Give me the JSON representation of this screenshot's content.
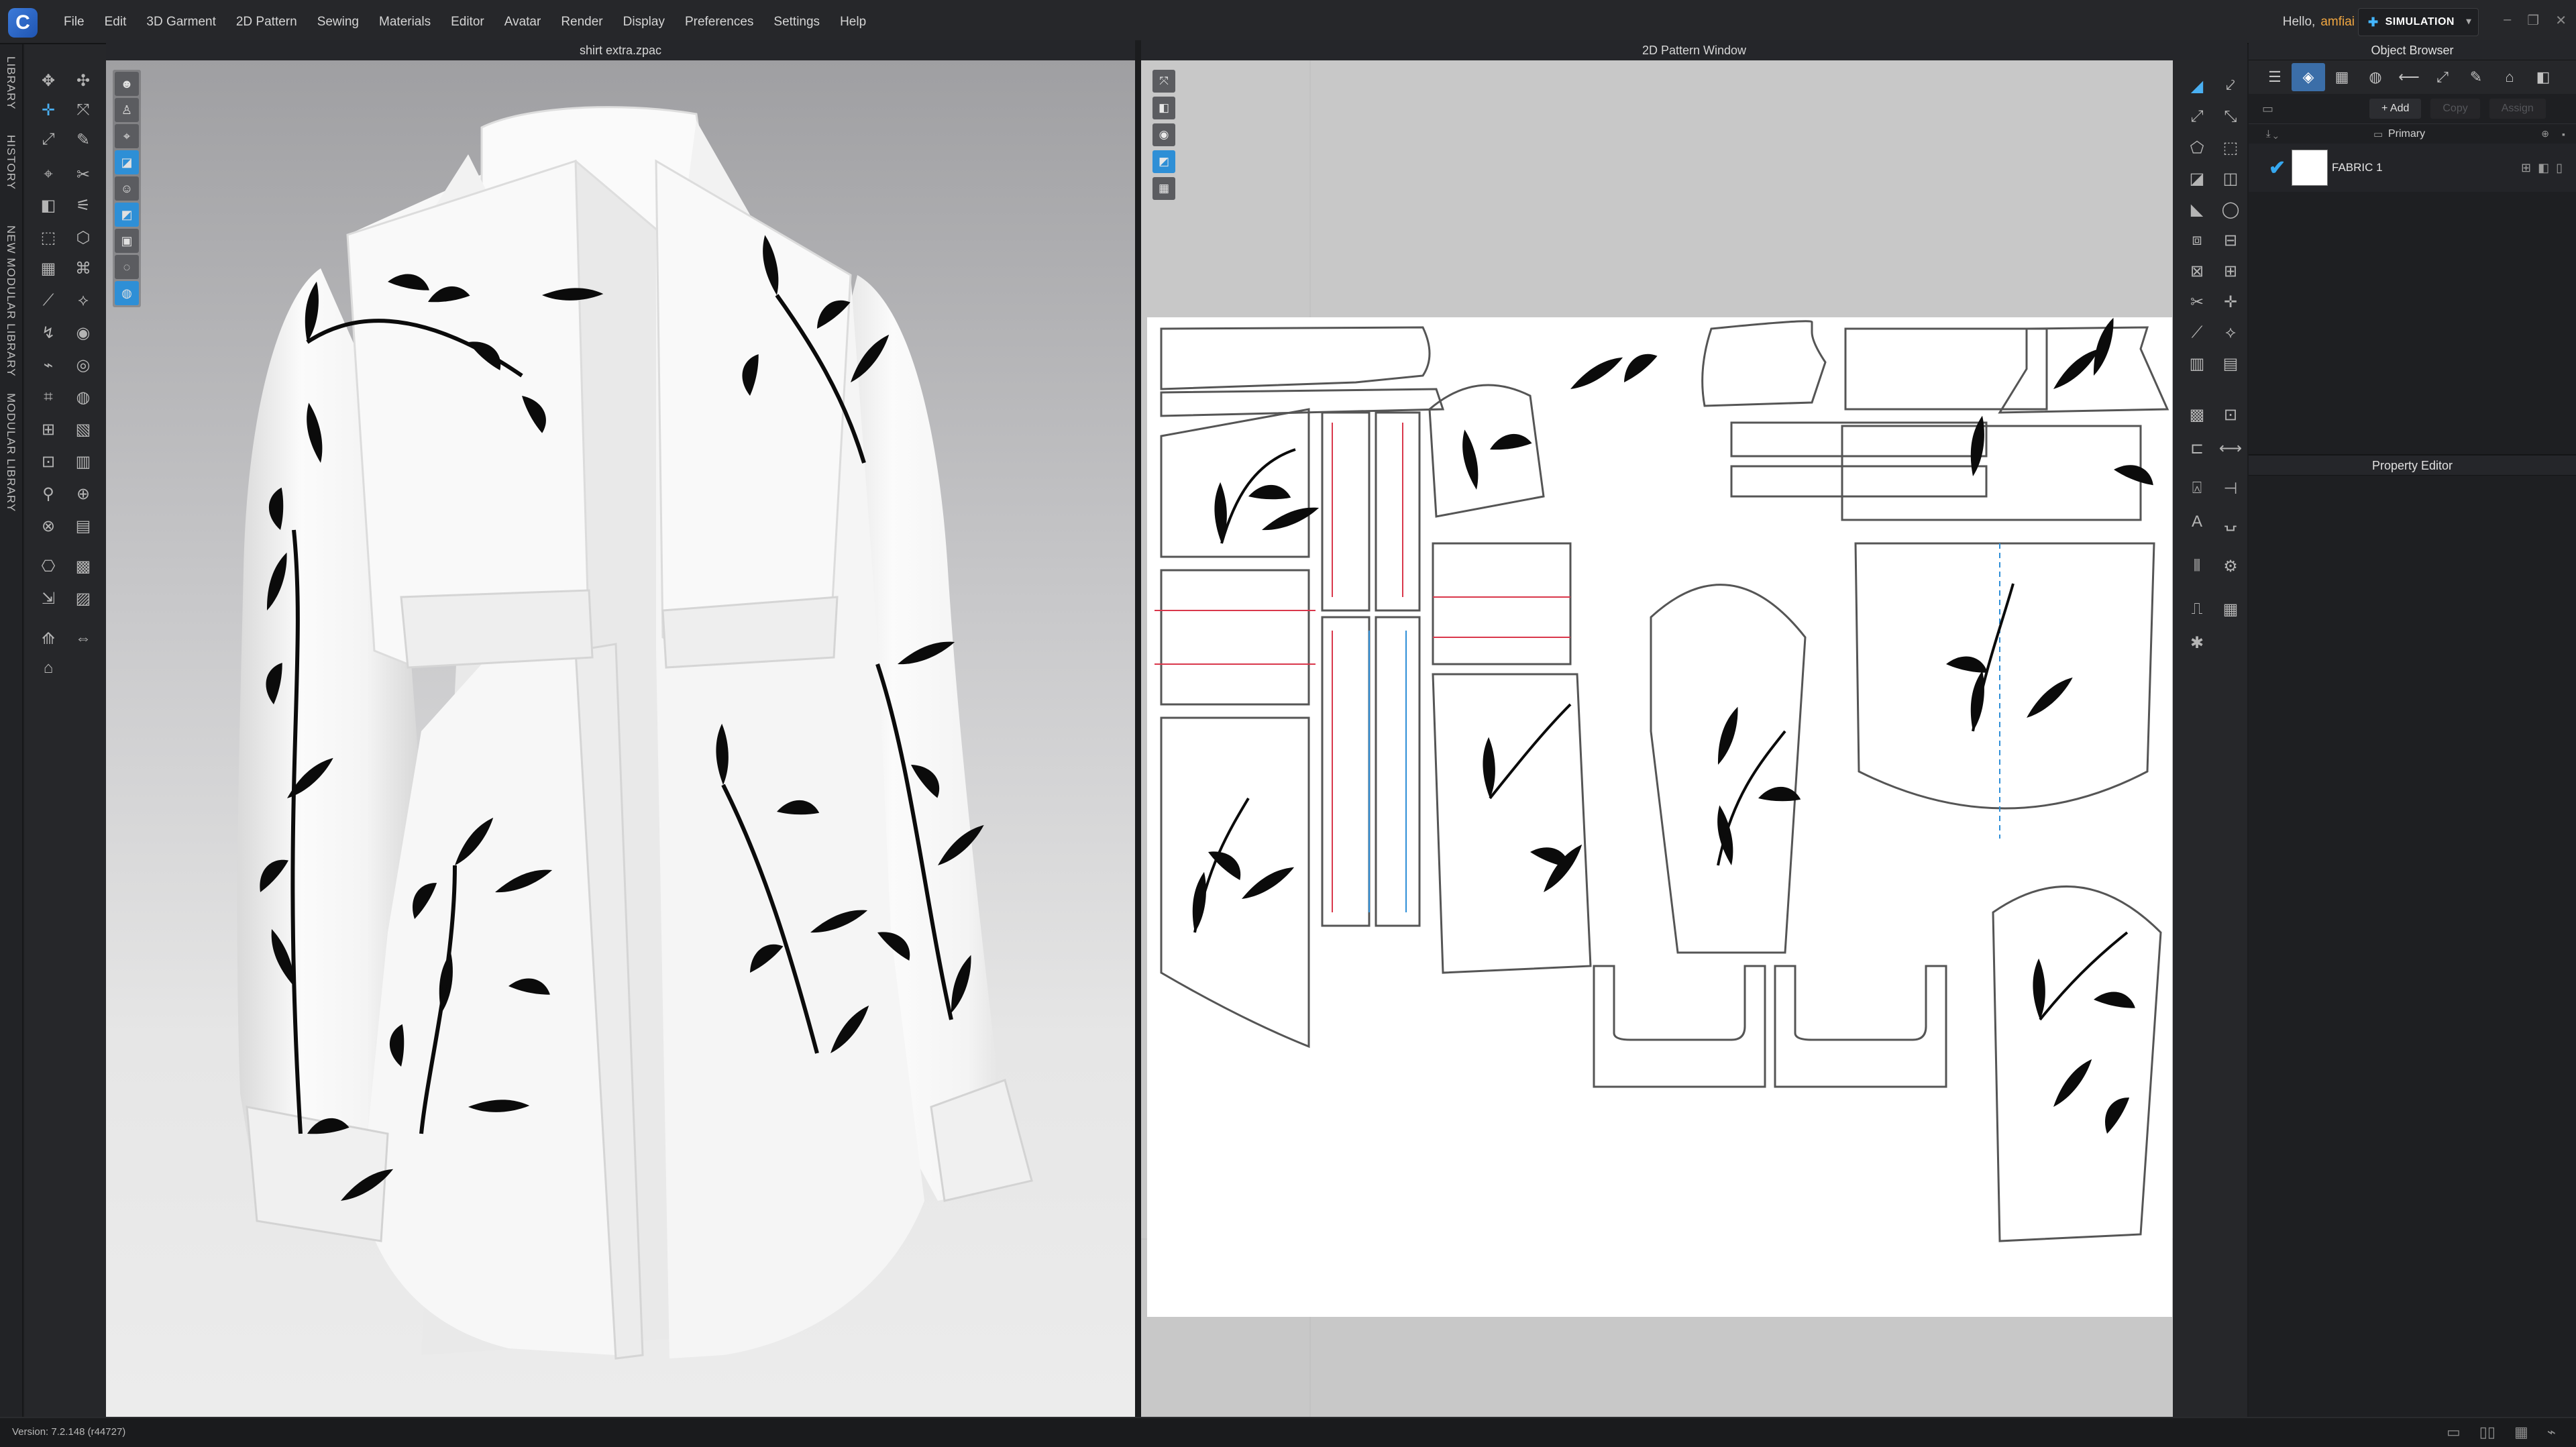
{
  "menu": {
    "items": [
      "File",
      "Edit",
      "3D Garment",
      "2D Pattern",
      "Sewing",
      "Materials",
      "Editor",
      "Avatar",
      "Render",
      "Display",
      "Preferences",
      "Settings",
      "Help"
    ]
  },
  "user": {
    "greeting": "Hello,",
    "name": "amfiai"
  },
  "mode": {
    "label": "SIMULATION"
  },
  "side_tabs": [
    "LIBRARY",
    "HISTORY",
    "NEW MODULAR LIBRARY",
    "MODULAR LIBRARY"
  ],
  "viewport": {
    "title": "shirt extra.zpac"
  },
  "pattern_window": {
    "title": "2D Pattern Window"
  },
  "object_browser": {
    "title": "Object Browser",
    "actions": {
      "add": "+ Add",
      "copy": "Copy",
      "assign": "Assign"
    },
    "group": "Primary",
    "fabric": {
      "name": "FABRIC 1",
      "swatch_color": "#ffffff",
      "checked": true
    }
  },
  "property_editor": {
    "title": "Property Editor"
  },
  "status": {
    "version": "Version: 7.2.148 (r44727)"
  },
  "colors": {
    "accent": "#36a8f0",
    "username": "#f0a641",
    "panel_bg": "#1e1f22"
  }
}
